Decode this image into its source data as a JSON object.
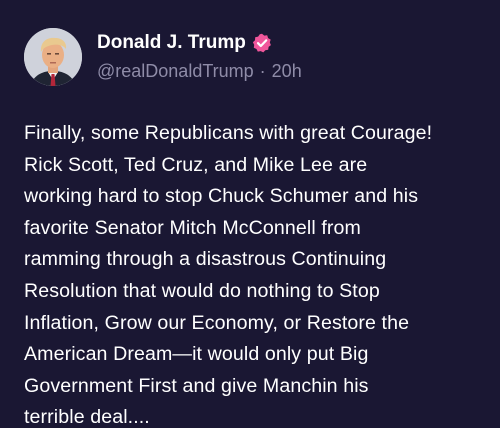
{
  "post": {
    "author": {
      "display_name": "Donald J. Trump",
      "handle": "@realDonaldTrump",
      "verified": true,
      "avatar_icon": "profile-photo"
    },
    "separator": "·",
    "timestamp": "20h",
    "text": "Finally, some Republicans with great Courage!\nRick Scott, Ted Cruz, and Mike Lee are\nworking hard to stop Chuck Schumer and his\nfavorite Senator Mitch McConnell from\nramming through a disastrous Continuing\nResolution that would do nothing to Stop\nInflation, Grow our Economy, or Restore the\nAmerican Dream—it would only put Big\nGovernment First and give Manchin his\nterrible deal...."
  },
  "colors": {
    "background": "#1a1733",
    "text": "#ffffff",
    "muted": "#8f8ca8",
    "verified_badge": "#f0569b"
  }
}
